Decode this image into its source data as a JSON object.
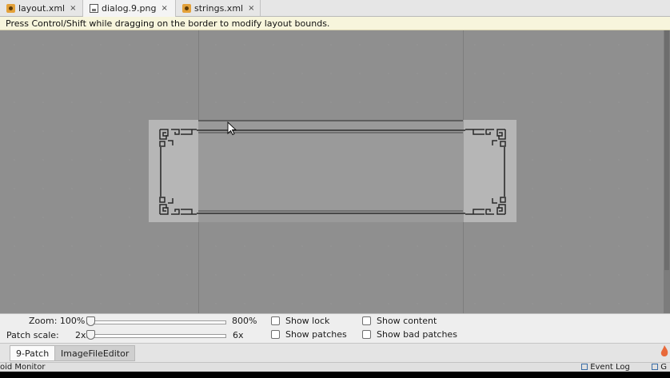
{
  "tabs": [
    {
      "label": "layout.xml",
      "icon": "xml-file-icon"
    },
    {
      "label": "dialog.9.png",
      "icon": "image-file-icon"
    },
    {
      "label": "strings.xml",
      "icon": "xml-file-icon"
    }
  ],
  "tab_close_glyph": "×",
  "hint": "Press Control/Shift while dragging on the border to modify layout bounds.",
  "controls": {
    "zoom_label": "Zoom: 100%",
    "zoom_max": "800%",
    "patch_scale_label": "Patch scale:",
    "patch_scale_value": "2x",
    "patch_scale_max": "6x",
    "show_lock": "Show lock",
    "show_patches": "Show patches",
    "show_content": "Show content",
    "show_bad_patches": "Show bad patches"
  },
  "bottom_tabs": [
    "9-Patch",
    "ImageFileEditor"
  ],
  "status": {
    "left": "oid Monitor",
    "event_log": "Event Log",
    "right": "G"
  },
  "colors": {
    "canvas": "#8f8f8f",
    "hint_bg": "#f7f5dc",
    "panel": "#eeeeee",
    "frame_stroke": "#2d2d2d"
  }
}
